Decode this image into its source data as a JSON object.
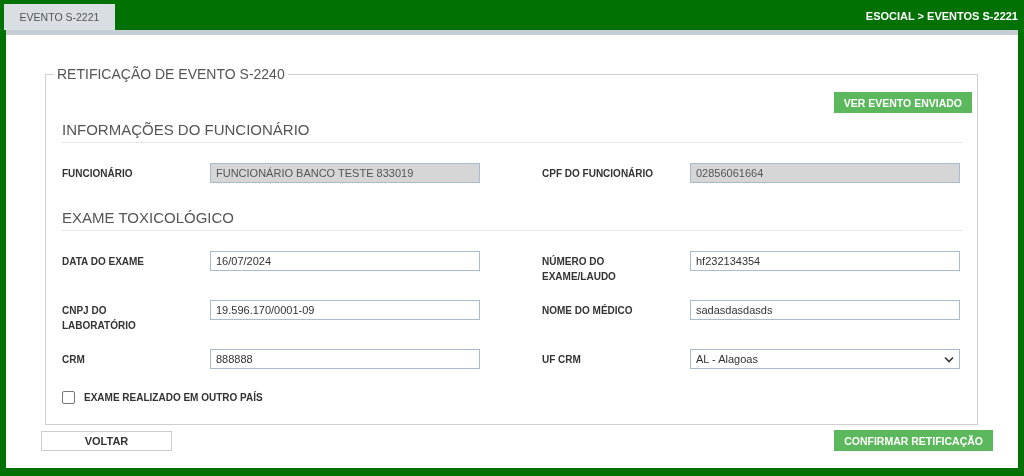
{
  "tab": {
    "label": "EVENTO S-2221",
    "selected": true
  },
  "breadcrumb": "ESOCIAL > EVENTOS S-2221",
  "form": {
    "legend": "RETIFICAÇÃO DE EVENTO S-2240",
    "view_button": "VER EVENTO ENVIADO",
    "sections": [
      {
        "title": "INFORMAÇÕES DO FUNCIONÁRIO",
        "fields": [
          {
            "label": "FUNCIONÁRIO",
            "value": "FUNCIONÁRIO BANCO TESTE 833019",
            "kind": "text",
            "disabled": true
          },
          {
            "label": "CPF DO FUNCIONÁRIO",
            "value": "02856061664",
            "kind": "text",
            "disabled": true
          }
        ]
      },
      {
        "title": "EXAME TOXICOLÓGICO",
        "fields": [
          {
            "label": "DATA DO EXAME",
            "value": "16/07/2024",
            "kind": "text",
            "disabled": false
          },
          {
            "label": "NÚMERO DO EXAME/LAUDO",
            "value": "hf232134354",
            "kind": "text",
            "disabled": false
          },
          {
            "label": "CNPJ DO LABORATÓRIO",
            "value": "19.596.170/0001-09",
            "kind": "text",
            "disabled": false
          },
          {
            "label": "NOME DO MÉDICO",
            "value": "sadasdasdasds",
            "kind": "text",
            "disabled": false
          },
          {
            "label": "CRM",
            "value": "888888",
            "kind": "text",
            "disabled": false
          },
          {
            "label": "UF CRM",
            "value": "AL - Alagoas",
            "kind": "select",
            "disabled": false
          }
        ]
      }
    ],
    "checkbox": {
      "label": "EXAME REALIZADO EM OUTRO PAÍS",
      "checked": false
    }
  },
  "buttons": {
    "back": "VOLTAR",
    "confirm": "CONFIRMAR RETIFICAÇÃO"
  }
}
